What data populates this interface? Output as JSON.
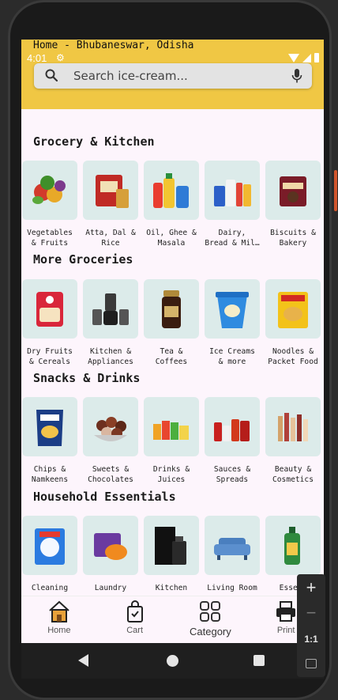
{
  "header": {
    "location": "Home - Bhubaneswar, Odisha",
    "time": "4:01",
    "search_placeholder": "Search ice-cream..."
  },
  "sections": [
    {
      "title": "Grocery & Kitchen",
      "items": [
        {
          "label": "Vegetables\n& Fruits",
          "icon": "vegetables-icon"
        },
        {
          "label": "Atta, Dal &\nRice",
          "icon": "atta-bag-icon"
        },
        {
          "label": "Oil, Ghee &\nMasala",
          "icon": "oil-bottle-icon"
        },
        {
          "label": "Dairy,\nBread & Mil…",
          "icon": "dairy-icon"
        },
        {
          "label": "Biscuits &\nBakery",
          "icon": "biscuit-pack-icon"
        }
      ]
    },
    {
      "title": "More Groceries",
      "items": [
        {
          "label": "Dry Fruits\n& Cereals",
          "icon": "cereal-pack-icon"
        },
        {
          "label": "Kitchen &\nAppliances",
          "icon": "mixer-icon"
        },
        {
          "label": "Tea &\nCoffees",
          "icon": "coffee-jar-icon"
        },
        {
          "label": "Ice Creams\n& more",
          "icon": "ice-cream-tub-icon"
        },
        {
          "label": "Noodles &\nPacket Food",
          "icon": "noodles-pack-icon"
        }
      ]
    },
    {
      "title": "Snacks & Drinks",
      "items": [
        {
          "label": "Chips &\nNamkeens",
          "icon": "chips-pack-icon"
        },
        {
          "label": "Sweets &\nChocolates",
          "icon": "sweets-bowl-icon"
        },
        {
          "label": "Drinks &\nJuices",
          "icon": "juice-bottles-icon"
        },
        {
          "label": "Sauces &\nSpreads",
          "icon": "sauce-bottles-icon"
        },
        {
          "label": "Beauty &\nCosmetics",
          "icon": "cosmetics-icon"
        }
      ]
    },
    {
      "title": "Household Essentials",
      "items": [
        {
          "label": "Cleaning",
          "icon": "detergent-pack-icon"
        },
        {
          "label": "Laundry",
          "icon": "soap-bar-icon"
        },
        {
          "label": "Kitchen",
          "icon": "perfume-box-icon"
        },
        {
          "label": "Living Room",
          "icon": "sofa-icon"
        },
        {
          "label": "Essent",
          "icon": "shampoo-bottle-icon"
        }
      ]
    }
  ],
  "bottom_nav": {
    "home": "Home",
    "cart": "Cart",
    "category": "Category",
    "print": "Print"
  },
  "zoom": {
    "plus": "+",
    "minus": "−",
    "reset": "1:1"
  },
  "colors": {
    "header_bg": "#f0c744",
    "screen_bg": "#fdf5fc",
    "tile_bg": "#dcebea"
  }
}
